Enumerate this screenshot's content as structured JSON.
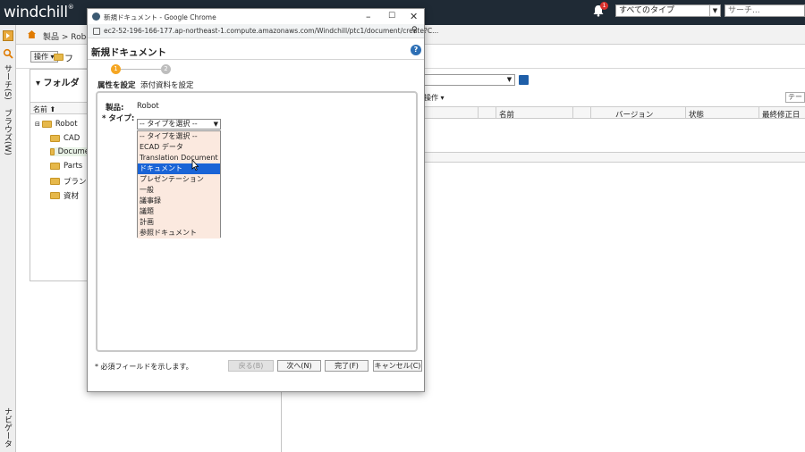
{
  "app": {
    "logo": "windchill",
    "notification_count": "1",
    "type_filter": "すべてのタイプ",
    "search_placeholder": "サーチ..."
  },
  "left_tabs": {
    "search": "サーチ(S)",
    "browse": "ブラウズ(W)",
    "navigator": "ナビゲータ"
  },
  "breadcrumb": "製品 > Robot",
  "folder_panel": {
    "ops_button": "操作 ▾",
    "title_fragment": "フ",
    "header": "フォルダ",
    "column_name": "名前 ⬆",
    "items": [
      "Robot",
      "CAD",
      "Docume",
      "Parts",
      "プラン",
      "資材"
    ]
  },
  "list_panel": {
    "ops": "操作 ▾",
    "filter": "テー",
    "columns": [
      "名前",
      "バージョン",
      "状態",
      "最終修正日"
    ]
  },
  "popup": {
    "window_title": "新規ドキュメント - Google Chrome",
    "url": "ec2-52-196-166-177.ap-northeast-1.compute.amazonaws.com/Windchill/ptc1/document/create?C...",
    "dialog_title": "新規ドキュメント",
    "help": "?",
    "steps": [
      {
        "num": "1",
        "label": "属性を設定"
      },
      {
        "num": "2",
        "label": "添付資料を設定"
      }
    ],
    "product_label": "製品:",
    "product_value": "Robot",
    "type_label": "* タイプ:",
    "type_selected": "-- タイプを選択 --",
    "type_options": [
      "-- タイプを選択 --",
      "ECAD データ",
      "Translation Document",
      "ドキュメント",
      "プレゼンテーション",
      "一般",
      "議事録",
      "議題",
      "計画",
      "参照ドキュメント"
    ],
    "highlighted_option": "ドキュメント",
    "required_note": "* 必須フィールドを示します。",
    "buttons": {
      "back": "戻る(B)",
      "next": "次へ(N)",
      "finish": "完了(F)",
      "cancel": "キャンセル(C)"
    }
  },
  "colors": {
    "topbar": "#1f2a35",
    "step_active": "#f5a623",
    "step_inactive": "#bdbdbd",
    "option_bg": "#fbe9df",
    "option_selected": "#1a64d6"
  }
}
